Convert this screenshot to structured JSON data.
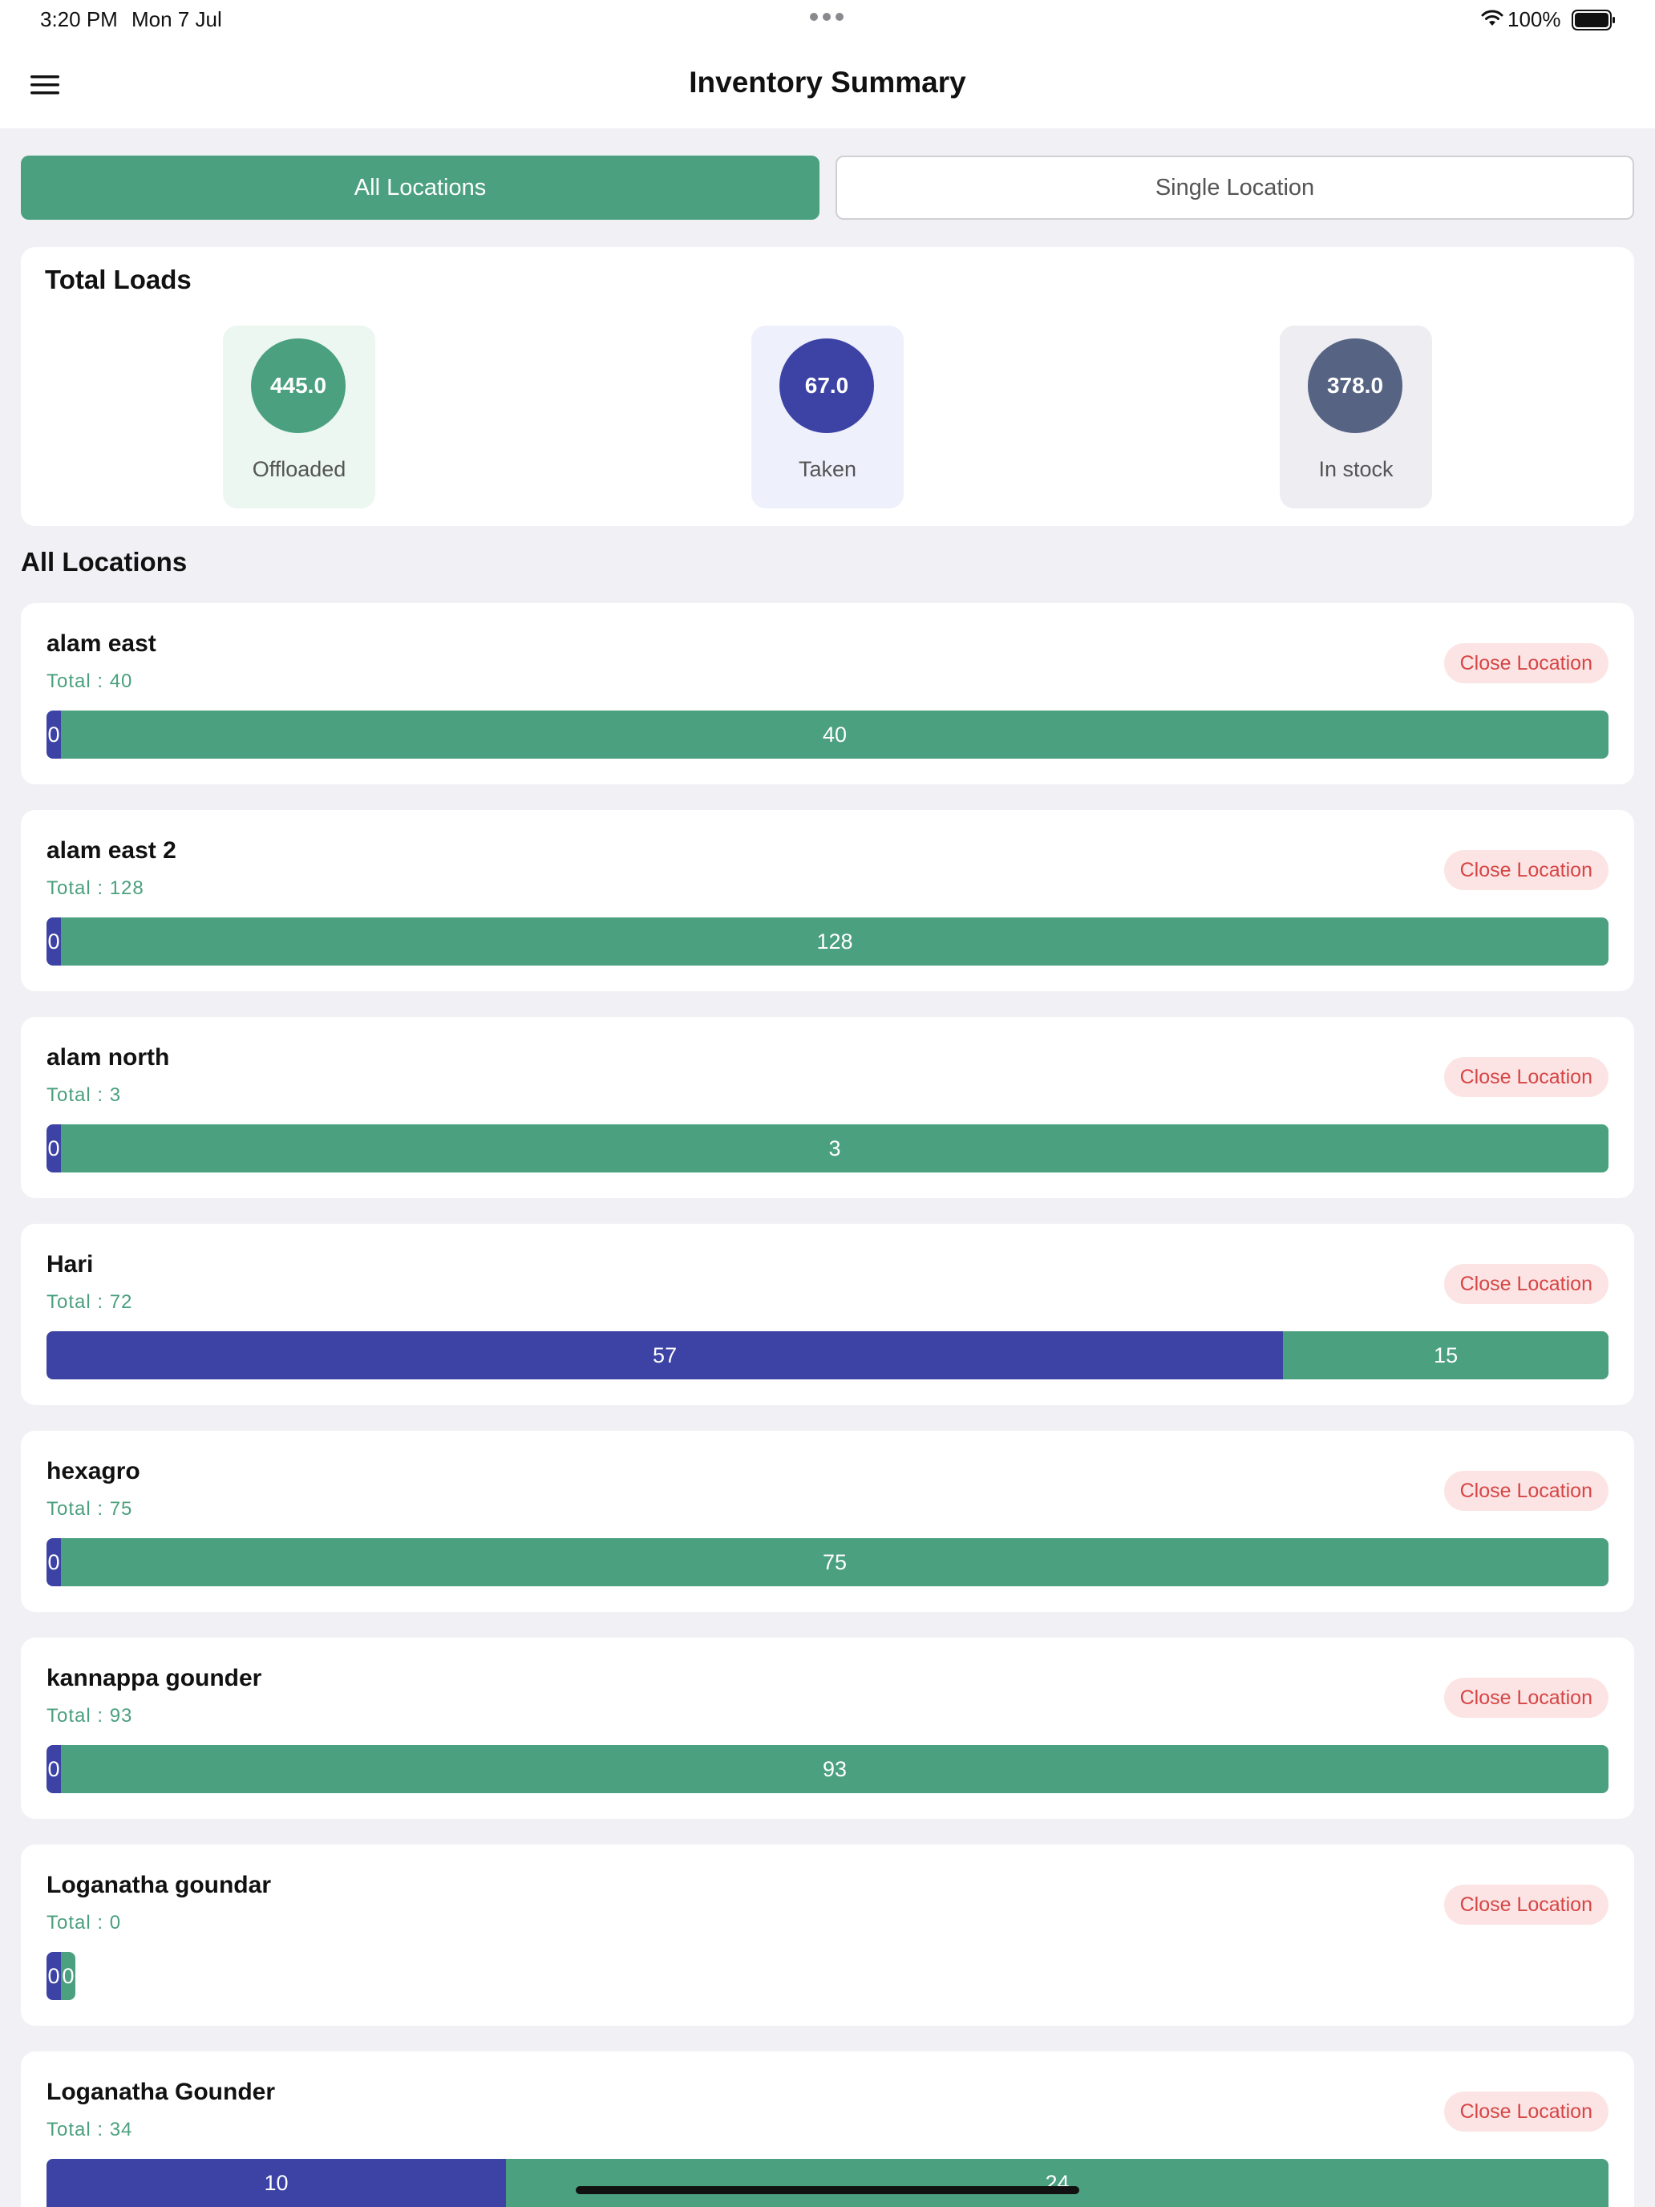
{
  "status_bar": {
    "time": "3:20 PM",
    "date": "Mon 7 Jul",
    "battery_pct": "100%"
  },
  "header": {
    "title": "Inventory Summary",
    "menu_icon": "hamburger-menu-icon"
  },
  "tabs": [
    {
      "label": "All Locations",
      "active": true
    },
    {
      "label": "Single Location",
      "active": false
    }
  ],
  "total_loads": {
    "title": "Total Loads",
    "stats": [
      {
        "value": "445.0",
        "label": "Offloaded",
        "color": "#4BA07F",
        "bg": "#EBF7F0"
      },
      {
        "value": "67.0",
        "label": "Taken",
        "color": "#3C43A4",
        "bg": "#EEF0FC"
      },
      {
        "value": "378.0",
        "label": "In stock",
        "color": "#566383",
        "bg": "#EDEDF2"
      }
    ]
  },
  "locations_heading": "All Locations",
  "close_label": "Close Location",
  "colors": {
    "taken": "#3C43A4",
    "in_stock": "#4BA07F",
    "accent": "#4BA07F",
    "danger": "#D64545"
  },
  "locations": [
    {
      "name": "alam east",
      "total": "Total : 40",
      "taken": 0,
      "stock": 40
    },
    {
      "name": "alam east 2",
      "total": "Total : 128",
      "taken": 0,
      "stock": 128
    },
    {
      "name": "alam north",
      "total": "Total : 3",
      "taken": 0,
      "stock": 3
    },
    {
      "name": "Hari",
      "total": "Total : 72",
      "taken": 57,
      "stock": 15
    },
    {
      "name": "hexagro",
      "total": "Total : 75",
      "taken": 0,
      "stock": 75
    },
    {
      "name": "kannappa gounder",
      "total": "Total : 93",
      "taken": 0,
      "stock": 93
    },
    {
      "name": "Loganatha goundar",
      "total": "Total : 0",
      "taken": 0,
      "stock": 0
    },
    {
      "name": "Loganatha Gounder",
      "total": "Total : 34",
      "taken": 10,
      "stock": 24
    }
  ]
}
